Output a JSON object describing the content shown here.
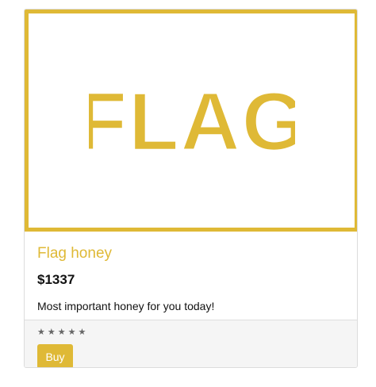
{
  "product": {
    "image_text": "FLAG",
    "title": "Flag honey",
    "price": "$1337",
    "description": "Most important honey for you today!",
    "rating": {
      "stars": 5,
      "glyph": "★"
    },
    "buy_label": "Buy"
  },
  "colors": {
    "accent": "#dfb936",
    "star": "#666666",
    "footer_bg": "#f5f5f5"
  },
  "icons": {
    "rating": "star-icon"
  }
}
